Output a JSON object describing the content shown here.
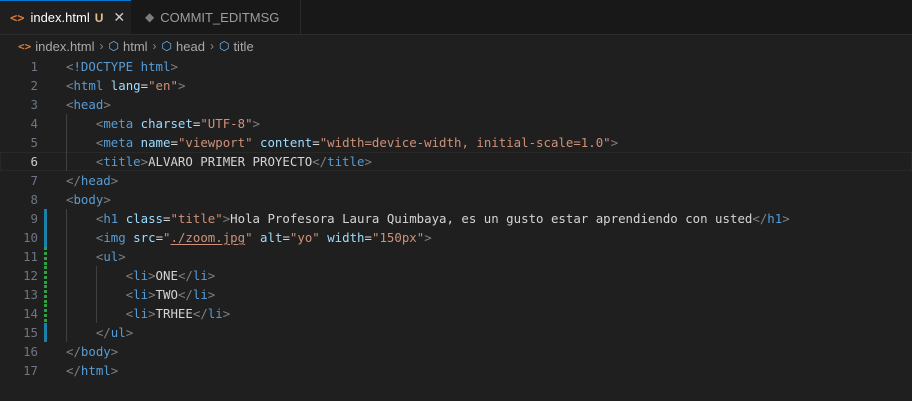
{
  "tabs": [
    {
      "label": "index.html",
      "modified": "U",
      "icon": "html-file-icon",
      "active": true
    },
    {
      "label": "COMMIT_EDITMSG",
      "icon": "git-commit-file-icon",
      "active": false
    }
  ],
  "breadcrumbs": [
    "index.html",
    "html",
    "head",
    "title"
  ],
  "editor": {
    "current_line": 6,
    "lines": [
      {
        "n": "1",
        "t": "<!DOCTYPE html>"
      },
      {
        "n": "2",
        "t": "<html lang=\"en\">"
      },
      {
        "n": "3",
        "t": "<head>"
      },
      {
        "n": "4",
        "t": "    <meta charset=\"UTF-8\">"
      },
      {
        "n": "5",
        "t": "    <meta name=\"viewport\" content=\"width=device-width, initial-scale=1.0\">"
      },
      {
        "n": "6",
        "t": "    <title>ALVARO PRIMER PROYECTO</title>"
      },
      {
        "n": "7",
        "t": "</head>"
      },
      {
        "n": "8",
        "t": "<body>"
      },
      {
        "n": "9",
        "t": "    <h1 class=\"title\">Hola Profesora Laura Quimbaya, es un gusto estar aprendiendo con usted</h1>"
      },
      {
        "n": "10",
        "t": "    <img src=\"./zoom.jpg\" alt=\"yo\" width=\"150px\">"
      },
      {
        "n": "11",
        "t": "    <ul>"
      },
      {
        "n": "12",
        "t": "        <li>ONE</li>"
      },
      {
        "n": "13",
        "t": "        <li>TWO</li>"
      },
      {
        "n": "14",
        "t": "        <li>TRHEE</li>"
      },
      {
        "n": "15",
        "t": "    </ul>"
      },
      {
        "n": "16",
        "t": "</body>"
      },
      {
        "n": "17",
        "t": "</html>"
      }
    ]
  },
  "colors": {
    "background": "#1f1f1f",
    "tag": "#569cd6",
    "attribute": "#9cdcfe",
    "string": "#ce9178",
    "text": "#d4d4d4",
    "active_tab_border": "#0078d4",
    "modified_gutter": "#1b81a8",
    "added_gutter": "#2ea043"
  }
}
